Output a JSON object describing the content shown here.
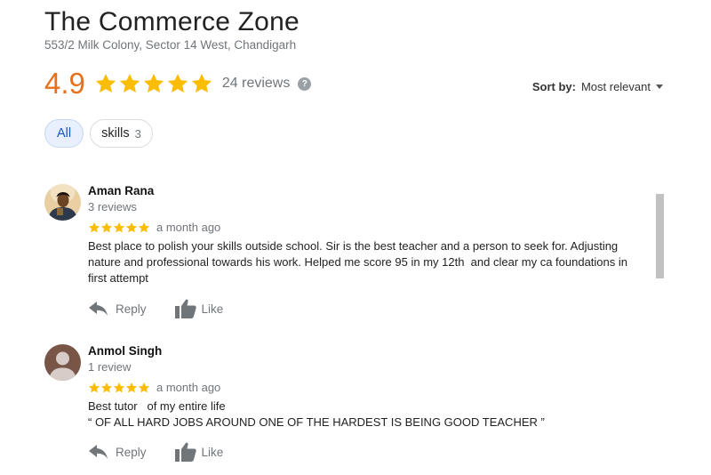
{
  "business": {
    "name": "The Commerce Zone",
    "address": "553/2 Milk Colony, Sector 14 West, Chandigarh"
  },
  "summary": {
    "rating": "4.9",
    "stars": 5,
    "review_count_text": "24 reviews",
    "help_icon": "help-icon",
    "rating_color": "#e7711b",
    "star_color": "#fbbc04"
  },
  "sort": {
    "label": "Sort by:",
    "value": "Most relevant"
  },
  "filters": [
    {
      "label": "All",
      "count": ""
    },
    {
      "label": "skills",
      "count": "3"
    }
  ],
  "reviews": [
    {
      "name": "Aman Rana",
      "meta": "3 reviews",
      "stars": 5,
      "date": "a month ago",
      "text": "Best place to polish your skills outside school. Sir is the best teacher and a person to seek for. Adjusting nature and professional towards his work. Helped me score 95 in my 12th  and clear my ca foundations in first attempt",
      "reply_label": "Reply",
      "like_label": "Like"
    },
    {
      "name": "Anmol Singh",
      "meta": "1 review",
      "stars": 5,
      "date": "a month ago",
      "text": "Best tutor   of my entire life\n“ OF ALL HARD JOBS AROUND ONE OF THE HARDEST IS BEING GOOD TEACHER ”",
      "reply_label": "Reply",
      "like_label": "Like"
    }
  ]
}
